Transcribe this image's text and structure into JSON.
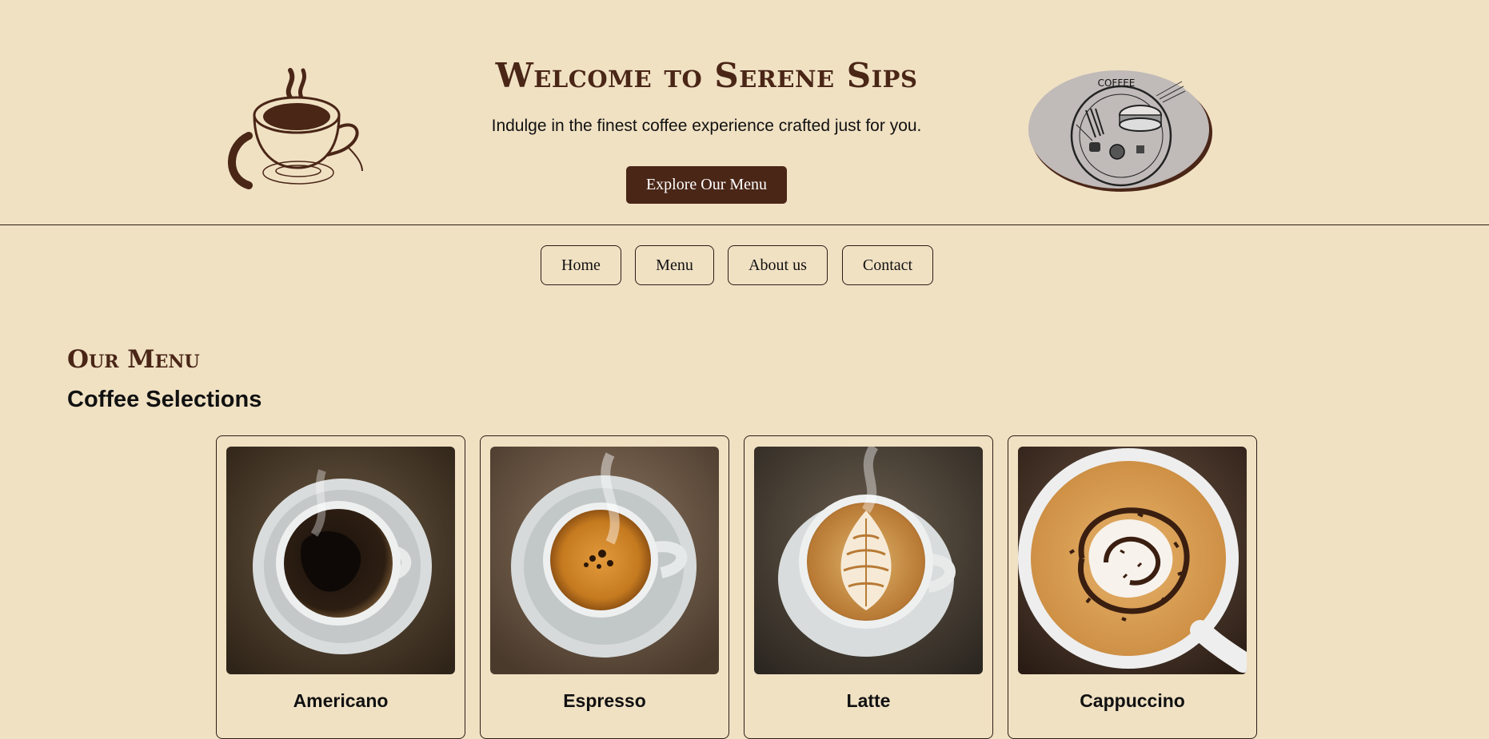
{
  "hero": {
    "title": "Welcome to Serene Sips",
    "subtitle": "Indulge in the finest coffee experience crafted just for you.",
    "cta_label": "Explore Our Menu",
    "plate_logo_text": "COFFEE"
  },
  "nav": {
    "items": [
      {
        "label": "Home"
      },
      {
        "label": "Menu"
      },
      {
        "label": "About us"
      },
      {
        "label": "Contact"
      }
    ]
  },
  "menu": {
    "title": "Our Menu",
    "subtitle": "Coffee Selections",
    "items": [
      {
        "name": "Americano",
        "image_icon": "americano-cup-icon"
      },
      {
        "name": "Espresso",
        "image_icon": "espresso-cup-icon"
      },
      {
        "name": "Latte",
        "image_icon": "latte-cup-icon"
      },
      {
        "name": "Cappuccino",
        "image_icon": "cappuccino-cup-icon"
      }
    ]
  },
  "colors": {
    "background": "#f0e1c3",
    "brand_brown": "#4a2617",
    "border": "#2a1d15"
  }
}
